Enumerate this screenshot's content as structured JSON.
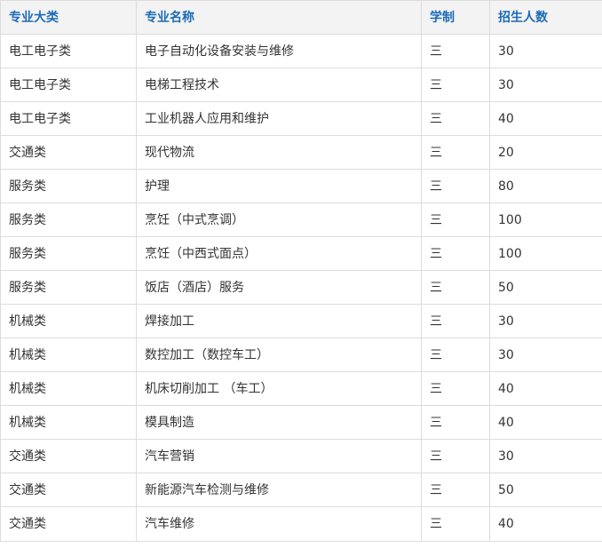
{
  "table": {
    "headers": [
      "专业大类",
      "专业名称",
      "学制",
      "招生人数"
    ],
    "rows": [
      [
        "电工电子类",
        "电子自动化设备安装与维修",
        "三",
        "30"
      ],
      [
        "电工电子类",
        "电梯工程技术",
        "三",
        "30"
      ],
      [
        "电工电子类",
        "工业机器人应用和维护",
        "三",
        "40"
      ],
      [
        "交通类",
        "现代物流",
        "三",
        "20"
      ],
      [
        "服务类",
        "护理",
        "三",
        "80"
      ],
      [
        "服务类",
        "烹饪（中式烹调）",
        "三",
        "100"
      ],
      [
        "服务类",
        "烹饪（中西式面点）",
        "三",
        "100"
      ],
      [
        "服务类",
        "饭店（酒店）服务",
        "三",
        "50"
      ],
      [
        "机械类",
        "焊接加工",
        "三",
        "30"
      ],
      [
        "机械类",
        "数控加工（数控车工）",
        "三",
        "30"
      ],
      [
        "机械类",
        "机床切削加工 （车工）",
        "三",
        "40"
      ],
      [
        "机械类",
        "模具制造",
        "三",
        "40"
      ],
      [
        "交通类",
        "汽车营销",
        "三",
        "30"
      ],
      [
        "交通类",
        "新能源汽车检测与维修",
        "三",
        "50"
      ],
      [
        "交通类",
        "汽车维修",
        "三",
        "40"
      ]
    ]
  }
}
